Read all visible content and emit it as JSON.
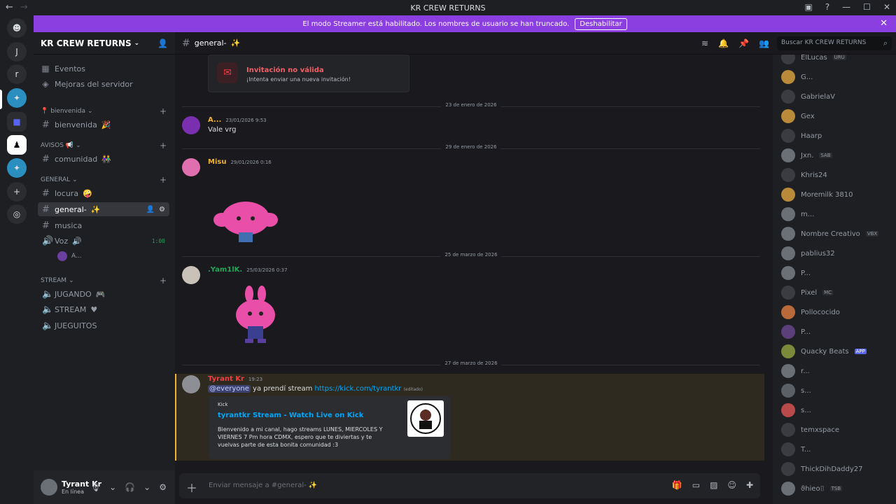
{
  "window": {
    "title": "KR CREW RETURNS"
  },
  "banner": {
    "text": "El modo Streamer está habilitado. Los nombres de usuario se han truncado.",
    "button": "Deshabilitar"
  },
  "guilds": {
    "letters": [
      "J",
      "r"
    ]
  },
  "sidebar": {
    "server_name": "KR CREW RETURNS",
    "events": "Eventos",
    "boosts": "Mejoras del servidor",
    "categories": {
      "bienvenida": "bienvenida",
      "avisos": "AVISOS",
      "general": "GENERAL",
      "stream": "STREAM"
    },
    "channels": {
      "bienvenida": "bienvenida",
      "comunidad": "comunidad",
      "locura": "locura",
      "general": "general-",
      "musica": "musica",
      "voz": "Voz",
      "voz_time": "1:00",
      "voz_user": "A...",
      "jugando": "JUGANDO",
      "stream": "STREAM",
      "jueguitos": "JUEGUITOS"
    }
  },
  "user_panel": {
    "name": "Tyrant Kr",
    "status": "En línea"
  },
  "header": {
    "channel": "general-",
    "search_placeholder": "Buscar KR CREW RETURNS"
  },
  "invite": {
    "title": "Invitación no válida",
    "subtitle": "¡Intenta enviar una nueva invitación!"
  },
  "dividers": [
    "23 de enero de 2026",
    "29 de enero de 2026",
    "25 de marzo de 2026",
    "27 de marzo de 2026"
  ],
  "messages": [
    {
      "author": "A...",
      "time": "23/01/2026 9:53",
      "text": "Vale vrg",
      "color": "#f0b232"
    },
    {
      "author": "Misu",
      "time": "29/01/2026 0:16",
      "text": "",
      "color": "#f0b232"
    },
    {
      "author": ".Yam1lK.",
      "time": "25/03/2026 0:37",
      "text": "",
      "color": "#23a559"
    },
    {
      "author": "Tyrant Kr",
      "time": "19:23",
      "mention": "@everyone",
      "text": " ya prendí stream ",
      "link": "https://kick.com/tyrantkr",
      "edited": "(editado)",
      "color": "#f23f43"
    }
  ],
  "embed": {
    "provider": "Kick",
    "title": "tyrantkr Stream - Watch Live on Kick",
    "description": "Bienvenido a mi canal, hago streams LUNES, MIERCOLES Y VIERNES 7 Pm hora CDMX, espero que te diviertas y te vuelvas parte de esta bonita comunidad :3",
    "thumb_text": "TYRANT KR"
  },
  "composer": {
    "placeholder": "Enviar mensaje a #general- ✨"
  },
  "members": [
    {
      "name": "ElLucas",
      "tag": "URU"
    },
    {
      "name": "G...",
      "tag": ""
    },
    {
      "name": "GabrielaV",
      "tag": ""
    },
    {
      "name": "Gex",
      "tag": ""
    },
    {
      "name": "Haarp",
      "tag": ""
    },
    {
      "name": "Jxn.",
      "tag": "SAB"
    },
    {
      "name": "Khris24",
      "tag": ""
    },
    {
      "name": "Moremilk 3810",
      "tag": ""
    },
    {
      "name": "m...",
      "tag": ""
    },
    {
      "name": "Nombre Creativo",
      "tag": "VBX"
    },
    {
      "name": "pablius32",
      "tag": ""
    },
    {
      "name": "P...",
      "tag": ""
    },
    {
      "name": "Pixel",
      "tag": "MC"
    },
    {
      "name": "Pollococido",
      "tag": ""
    },
    {
      "name": "P...",
      "tag": ""
    },
    {
      "name": "Quacky Beats",
      "tag": "APP"
    },
    {
      "name": "r...",
      "tag": ""
    },
    {
      "name": "s...",
      "tag": ""
    },
    {
      "name": "s...",
      "tag": ""
    },
    {
      "name": "temxspace",
      "tag": ""
    },
    {
      "name": "T...",
      "tag": ""
    },
    {
      "name": "ThickDihDaddy27",
      "tag": ""
    },
    {
      "name": "ϑhieo⌷",
      "tag": "TSB"
    }
  ]
}
